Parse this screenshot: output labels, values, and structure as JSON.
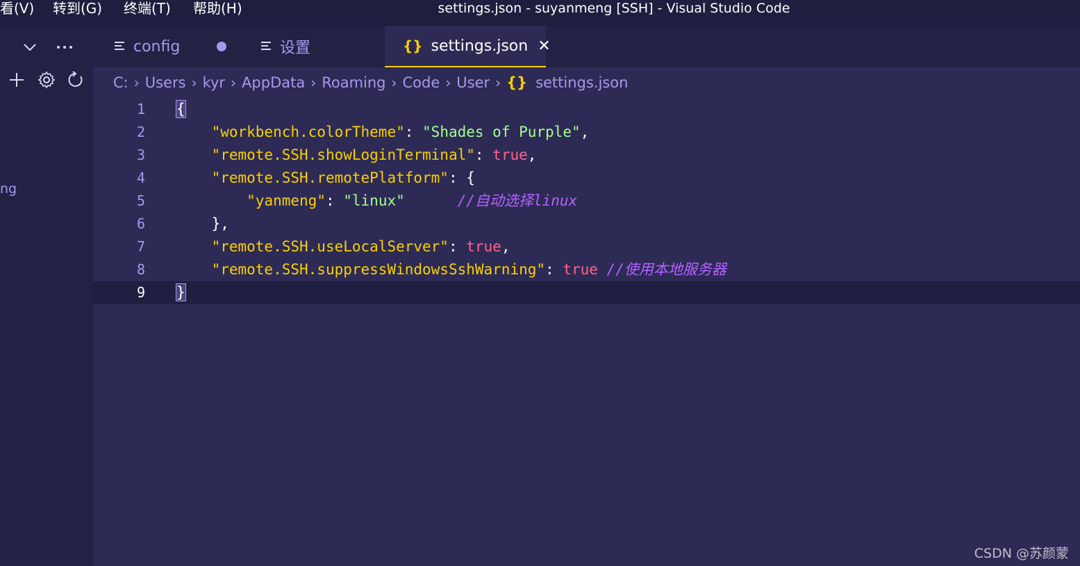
{
  "menu": [
    {
      "label": "看(V)"
    },
    {
      "label": "转到(G)"
    },
    {
      "label": "终端(T)"
    },
    {
      "label": "帮助(H)"
    }
  ],
  "window_title": "settings.json - suyanmeng [SSH] - Visual Studio Code",
  "sidebar": {
    "fragment_text": "ng",
    "icons": [
      "chevron-down-icon",
      "more-icon",
      "plus-icon",
      "gear-icon",
      "refresh-icon"
    ]
  },
  "tabs": [
    {
      "label": "config",
      "icon": "lines-icon",
      "modified": true
    },
    {
      "label": "设置",
      "icon": "lines-icon",
      "modified": false
    },
    {
      "label": "settings.json",
      "icon": "json-braces-icon",
      "active": true
    }
  ],
  "breadcrumb": {
    "items": [
      "C:",
      "Users",
      "kyr",
      "AppData",
      "Roaming",
      "Code",
      "User"
    ],
    "file_icon": "{}",
    "file": "settings.json"
  },
  "editor": {
    "line_numbers": [
      "1",
      "2",
      "3",
      "4",
      "5",
      "6",
      "7",
      "8",
      "9"
    ],
    "lines": {
      "l2_key": "\"workbench.colorTheme\"",
      "l2_val": "\"Shades of Purple\"",
      "l3_key": "\"remote.SSH.showLoginTerminal\"",
      "l3_val": "true",
      "l4_key": "\"remote.SSH.remotePlatform\"",
      "l5_key": "\"yanmeng\"",
      "l5_val": "\"linux\"",
      "l5_comment": "//自动选择linux",
      "l7_key": "\"remote.SSH.useLocalServer\"",
      "l7_val": "true",
      "l8_key": "\"remote.SSH.suppressWindowsSshWarning\"",
      "l8_val": "true",
      "l8_comment": "//使用本地服务器"
    }
  },
  "watermark": "CSDN @苏颜蒙",
  "colors": {
    "background": "#2d2b55",
    "sidebar": "#222244",
    "titlebar": "#1e1e3f",
    "key": "#fad000",
    "string": "#a5ff90",
    "boolean": "#ff628c",
    "comment": "#b362ff",
    "accent": "#a599e9"
  }
}
